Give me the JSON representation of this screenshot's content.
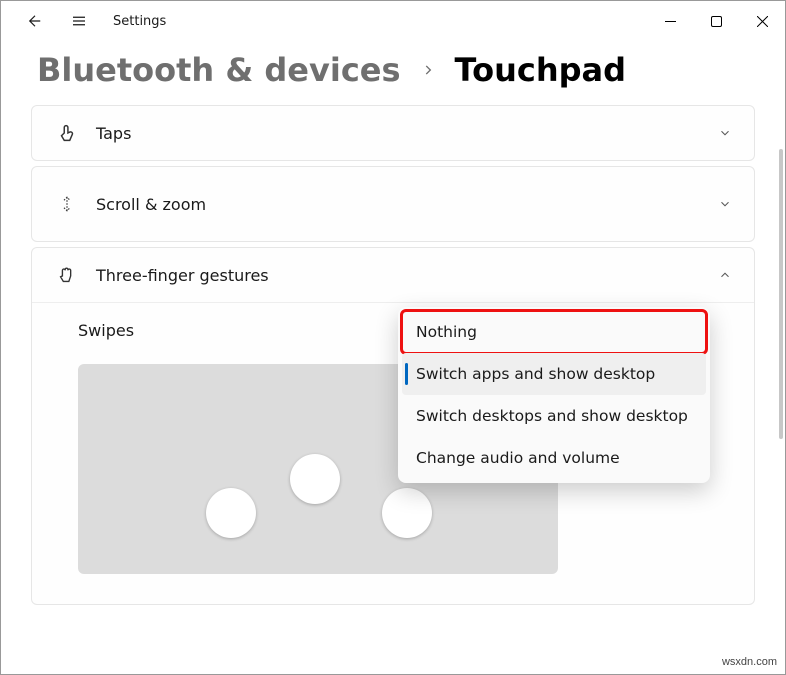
{
  "app_title": "Settings",
  "breadcrumb": {
    "parent": "Bluetooth & devices",
    "current": "Touchpad"
  },
  "cards": {
    "taps": {
      "label": "Taps"
    },
    "scroll_zoom": {
      "label": "Scroll & zoom"
    },
    "three_finger": {
      "label": "Three-finger gestures",
      "swipes_label": "Swipes"
    }
  },
  "dropdown": {
    "options": [
      "Nothing",
      "Switch apps and show desktop",
      "Switch desktops and show desktop",
      "Change audio and volume"
    ],
    "highlighted_index": 0,
    "selected_index": 1
  },
  "watermark": "wsxdn.com"
}
